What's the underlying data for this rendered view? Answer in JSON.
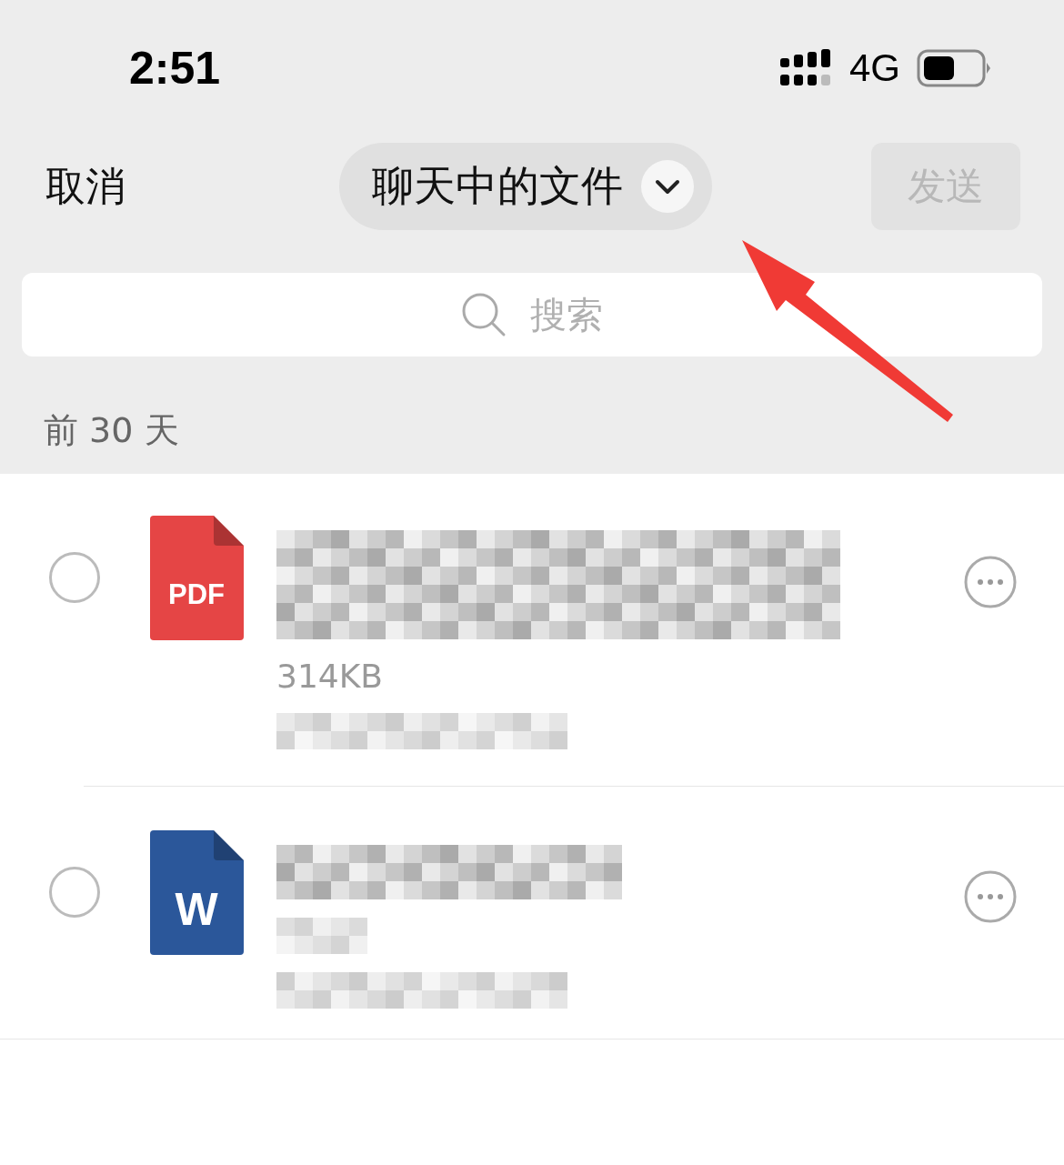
{
  "status_bar": {
    "time": "2:51",
    "network": "4G"
  },
  "header": {
    "cancel": "取消",
    "title": "聊天中的文件",
    "send": {
      "label": "发送",
      "disabled": true
    }
  },
  "search": {
    "placeholder": "搜索"
  },
  "section": "前 30 天",
  "files": [
    {
      "kind": "pdf",
      "icon_label": "PDF",
      "size": "314KB",
      "selected": false
    },
    {
      "kind": "word",
      "icon_label": "W",
      "selected": false
    }
  ]
}
